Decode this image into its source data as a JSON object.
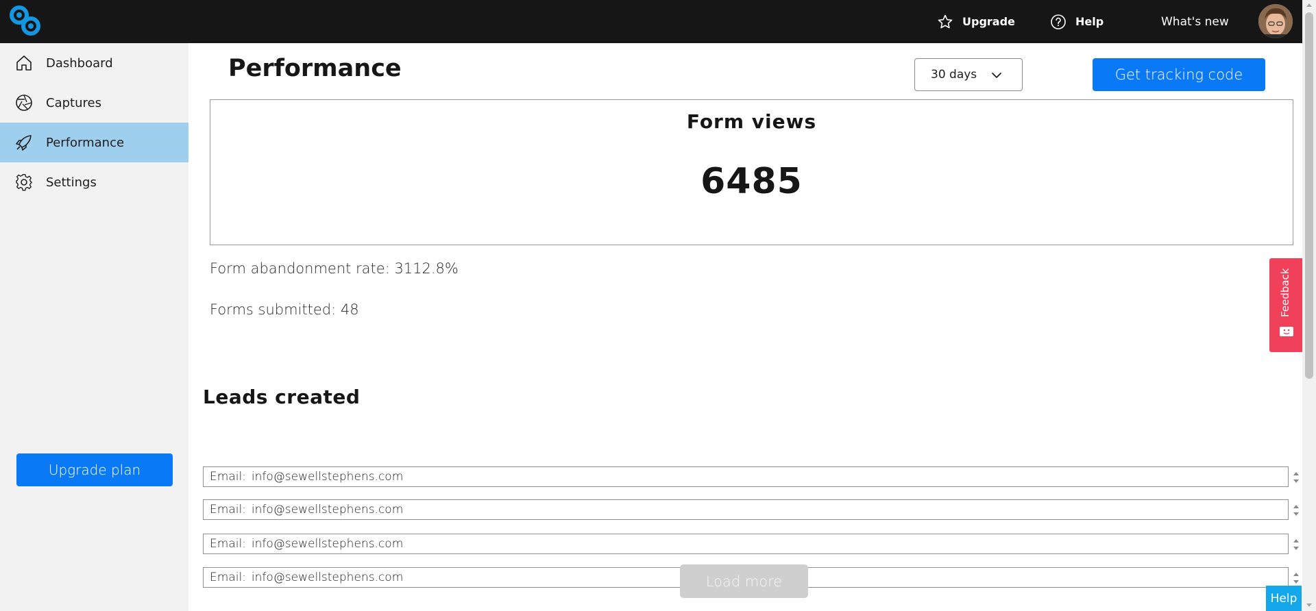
{
  "header": {
    "logo_icon": "link-logo-icon",
    "upgrade_label": "Upgrade",
    "upgrade_icon": "star-icon",
    "help_label": "Help",
    "help_icon": "question-circle-icon",
    "whats_new_label": "What's new",
    "avatar_icon": "user-avatar"
  },
  "sidebar": {
    "items": [
      {
        "label": "Dashboard",
        "icon": "home-icon",
        "active": false
      },
      {
        "label": "Captures",
        "icon": "aperture-icon",
        "active": false
      },
      {
        "label": "Performance",
        "icon": "rocket-icon",
        "active": true
      },
      {
        "label": "Settings",
        "icon": "gear-icon",
        "active": false
      }
    ],
    "upgrade_button": "Upgrade plan"
  },
  "main": {
    "title": "Performance",
    "range_select": {
      "selected": "30 days",
      "icon": "chevron-down-icon"
    },
    "tracking_button": "Get tracking code",
    "form_views": {
      "label": "Form views",
      "value": "6485"
    },
    "abandonment": "Form abandonment rate: 3112.8%",
    "submitted": "Forms submitted: 48",
    "leads_title": "Leads created",
    "leads": [
      {
        "key": "Email:",
        "value": "info@sewellstephens.com"
      },
      {
        "key": "Email:",
        "value": "info@sewellstephens.com"
      },
      {
        "key": "Email:",
        "value": "info@sewellstephens.com"
      },
      {
        "key": "Email:",
        "value": "info@sewellstephens.com"
      }
    ],
    "load_more": "Load more"
  },
  "widgets": {
    "feedback_label": "Feedback",
    "help_label": "Help"
  },
  "colors": {
    "accent": "#0a79f5",
    "nav_active": "#9fcfee",
    "topbar": "#161616",
    "feedback": "#f0405a",
    "help_widget": "#14a7ec"
  }
}
